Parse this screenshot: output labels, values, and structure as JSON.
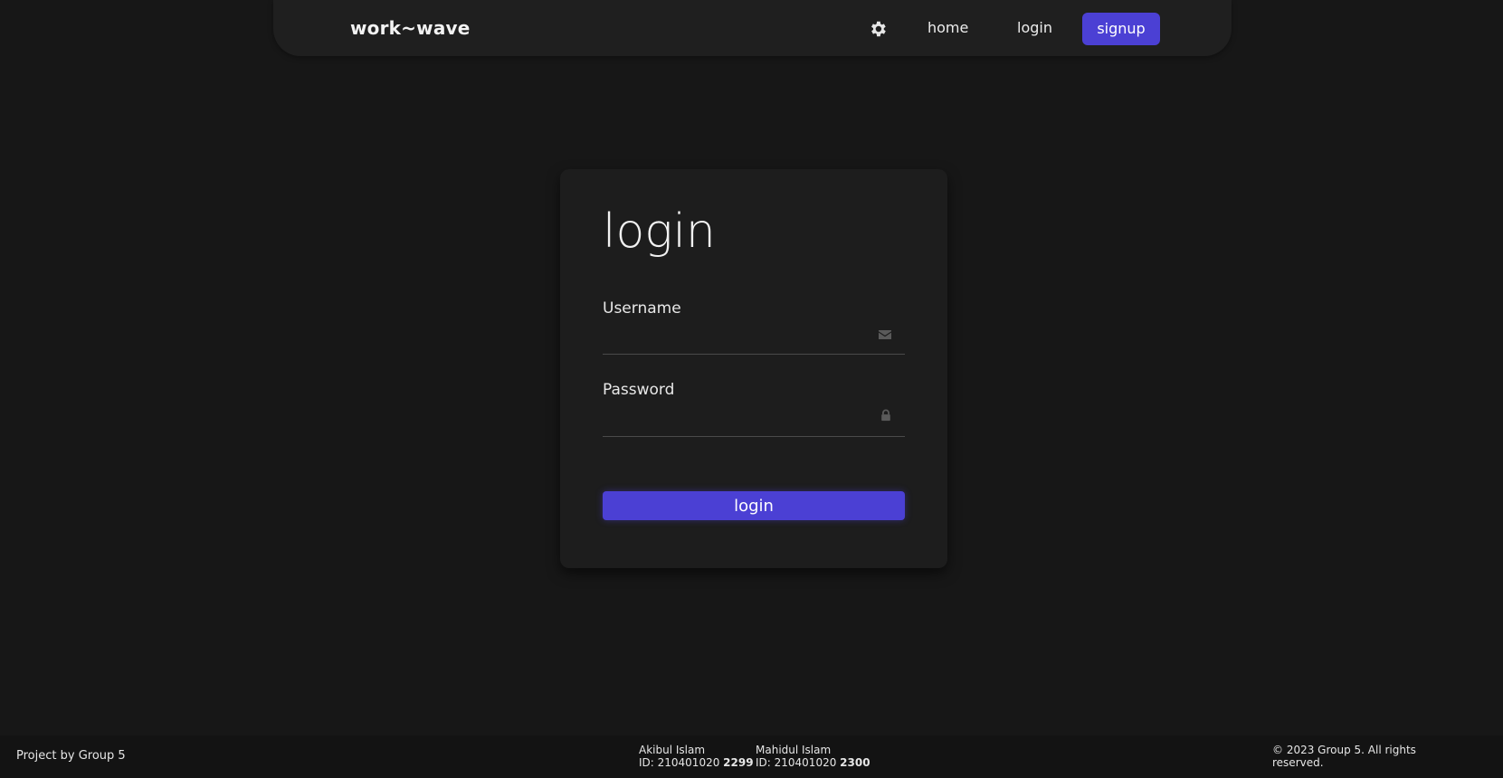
{
  "navbar": {
    "brand": "work~wave",
    "links": {
      "home": "home",
      "login": "login",
      "signup": "signup"
    },
    "accent_color": "#4b40d4"
  },
  "login_card": {
    "title": "login",
    "username_label": "Username",
    "username_value": "",
    "password_label": "Password",
    "password_value": "",
    "submit_label": "login",
    "icons": {
      "username": "envelope-icon",
      "password": "lock-icon"
    }
  },
  "footer": {
    "left_text": "Project by Group 5",
    "members": [
      {
        "name": "Akibul Islam",
        "id_prefix": "ID: 210401020 ",
        "id_suffix": "2299"
      },
      {
        "name": "Mahidul Islam",
        "id_prefix": "ID: 210401020 ",
        "id_suffix": "2300"
      }
    ],
    "copyright": "© 2023 Group 5. All rights reserved."
  }
}
